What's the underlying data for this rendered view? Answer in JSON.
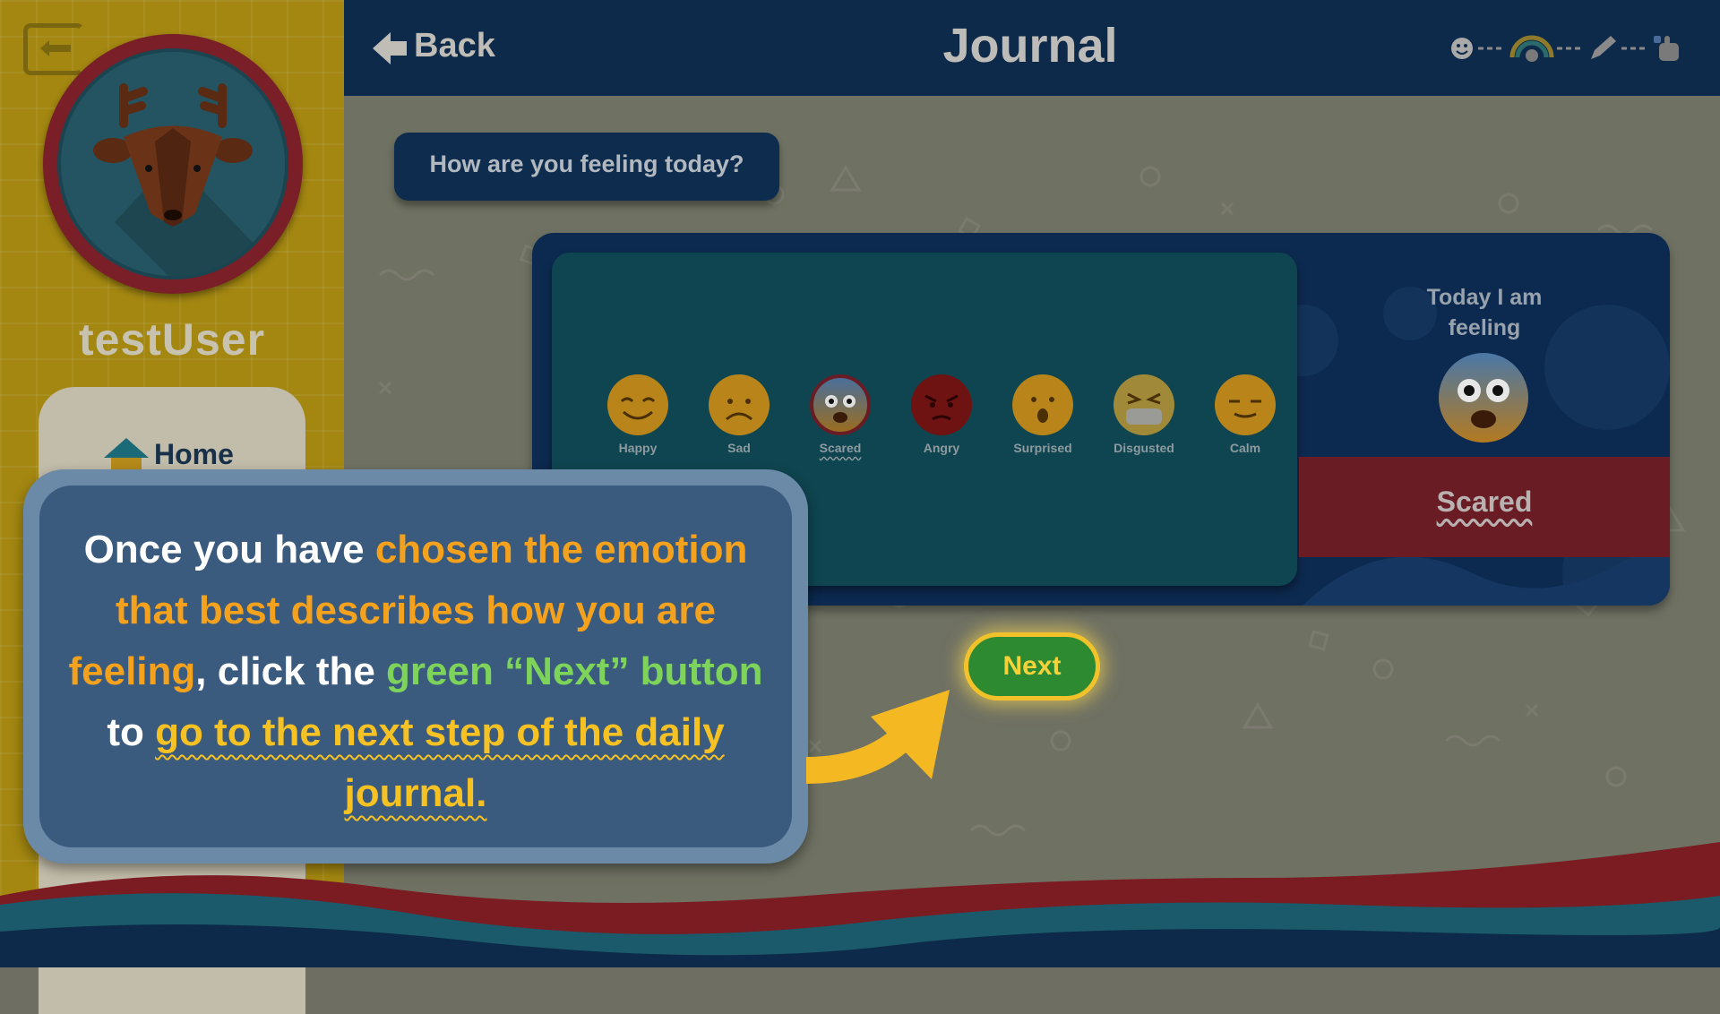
{
  "sidebar": {
    "username": "testUser",
    "nav": {
      "home_label": "Home"
    }
  },
  "header": {
    "back_label": "Back",
    "title": "Journal"
  },
  "journal": {
    "question": "How are you feeling today?",
    "emotions": [
      {
        "label": "Happy",
        "color": "#b9851a"
      },
      {
        "label": "Sad",
        "color": "#b9851a"
      },
      {
        "label": "Scared",
        "color": "#7f5c66",
        "selected": true
      },
      {
        "label": "Angry",
        "color": "#6e1212"
      },
      {
        "label": "Surprised",
        "color": "#b9851a"
      },
      {
        "label": "Disgusted",
        "color": "#a08a3a"
      },
      {
        "label": "Calm",
        "color": "#b9851a"
      }
    ],
    "selected_panel": {
      "heading": "Today I am feeling",
      "value": "Scared"
    },
    "next_label": "Next"
  },
  "tooltip": {
    "part1": "Once you have ",
    "part2": "chosen the emotion that best describes how you are feeling",
    "part3": ", click the ",
    "part4": "green “Next” button",
    "part5": " to ",
    "part6": "go to the next step of the daily journal."
  },
  "colors": {
    "header_bg": "#0d2a4a",
    "sidebar_bg": "#a38711",
    "next_button": "#2d8a31",
    "highlight_yellow": "#f6c122"
  }
}
